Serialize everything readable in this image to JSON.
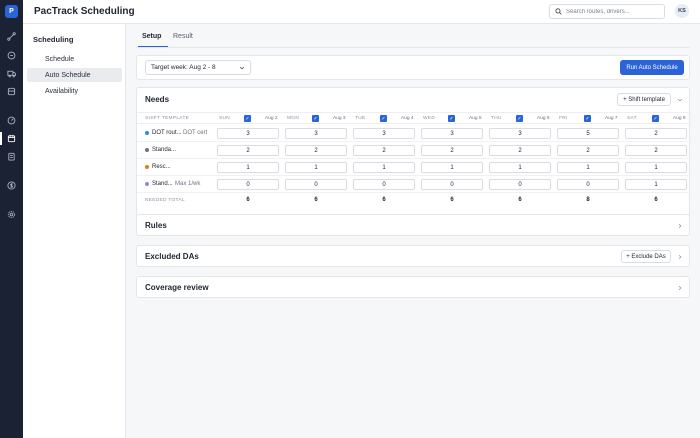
{
  "app": {
    "logo_letter": "P",
    "title": "PacTrack Scheduling"
  },
  "search": {
    "placeholder": "Search routes, drivers...",
    "value": ""
  },
  "user": {
    "initials": "KS"
  },
  "subnav": {
    "title": "Scheduling",
    "items": [
      {
        "label": "Schedule",
        "active": false
      },
      {
        "label": "Auto Schedule",
        "active": true
      },
      {
        "label": "Availability",
        "active": false
      }
    ]
  },
  "tabs": [
    {
      "label": "Setup",
      "active": true
    },
    {
      "label": "Result",
      "active": false
    }
  ],
  "target_week": {
    "label": "Target week: Aug 2 - 8"
  },
  "run_button": {
    "label": "Run Auto Schedule"
  },
  "needs": {
    "title": "Needs",
    "shift_template_button": "+ Shift template",
    "header_label": "SHIFT TEMPLATE",
    "days": [
      {
        "label": "SUN",
        "date": "Aug 2"
      },
      {
        "label": "MON",
        "date": "Aug 3"
      },
      {
        "label": "TUE",
        "date": "Aug 4"
      },
      {
        "label": "WED",
        "date": "Aug 5"
      },
      {
        "label": "THU",
        "date": "Aug 6"
      },
      {
        "label": "FRI",
        "date": "Aug 7"
      },
      {
        "label": "SAT",
        "date": "Aug 8"
      }
    ],
    "rows": [
      {
        "name": "DOT rout...",
        "note": "DOT cert",
        "dot_color": "#3b82f6",
        "values": [
          "3",
          "3",
          "3",
          "3",
          "3",
          "5",
          "2"
        ]
      },
      {
        "name": "Standa...",
        "note": "",
        "dot_color": "#6b7280",
        "values": [
          "2",
          "2",
          "2",
          "2",
          "2",
          "2",
          "2"
        ]
      },
      {
        "name": "Resc...",
        "note": "",
        "dot_color": "#f97316",
        "values": [
          "1",
          "1",
          "1",
          "1",
          "1",
          "1",
          "1"
        ]
      },
      {
        "name": "Stand...",
        "note": "Max 1/wk",
        "dot_color": "#8b8fc4",
        "values": [
          "0",
          "0",
          "0",
          "0",
          "0",
          "0",
          "1"
        ]
      }
    ],
    "total_label": "NEEDED TOTAL",
    "totals": [
      "6",
      "6",
      "6",
      "6",
      "6",
      "8",
      "6"
    ]
  },
  "rules": {
    "title": "Rules"
  },
  "excluded": {
    "title": "Excluded DAs",
    "button": "+ Exclude DAs"
  },
  "coverage": {
    "title": "Coverage review"
  },
  "colors": {
    "accent": "#2b63d9",
    "rail": "#1b2233"
  }
}
